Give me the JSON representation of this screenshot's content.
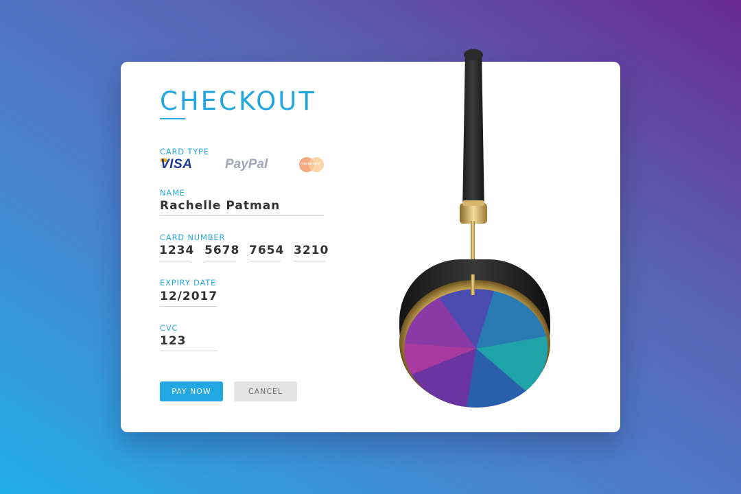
{
  "checkout": {
    "title": "CHECKOUT",
    "card_type_label": "CARD TYPE",
    "card_brands": [
      {
        "name": "VISA",
        "icon": "visa-logo"
      },
      {
        "name": "PayPal",
        "icon": "paypal-logo"
      },
      {
        "name": "mastercard",
        "icon": "mastercard-logo"
      }
    ],
    "name_label": "NAME",
    "name_value": "Rachelle Patman",
    "card_number_label": "CARD NUMBER",
    "card_number_groups": [
      "1234",
      "5678",
      "7654",
      "3210"
    ],
    "expiry_label": "EXPIRY DATE",
    "expiry_value": "12/2017",
    "cvc_label": "CVC",
    "cvc_value": "123",
    "pay_button_label": "PAY NOW",
    "cancel_button_label": "CANCEL"
  },
  "product": {
    "icon": "headphones-image"
  },
  "colors": {
    "accent": "#23a6e0",
    "button_primary": "#24a8e3",
    "button_secondary": "#e3e3e3",
    "text_dark": "#333333",
    "background_start": "#22aee8",
    "background_end": "#6a2a94"
  }
}
